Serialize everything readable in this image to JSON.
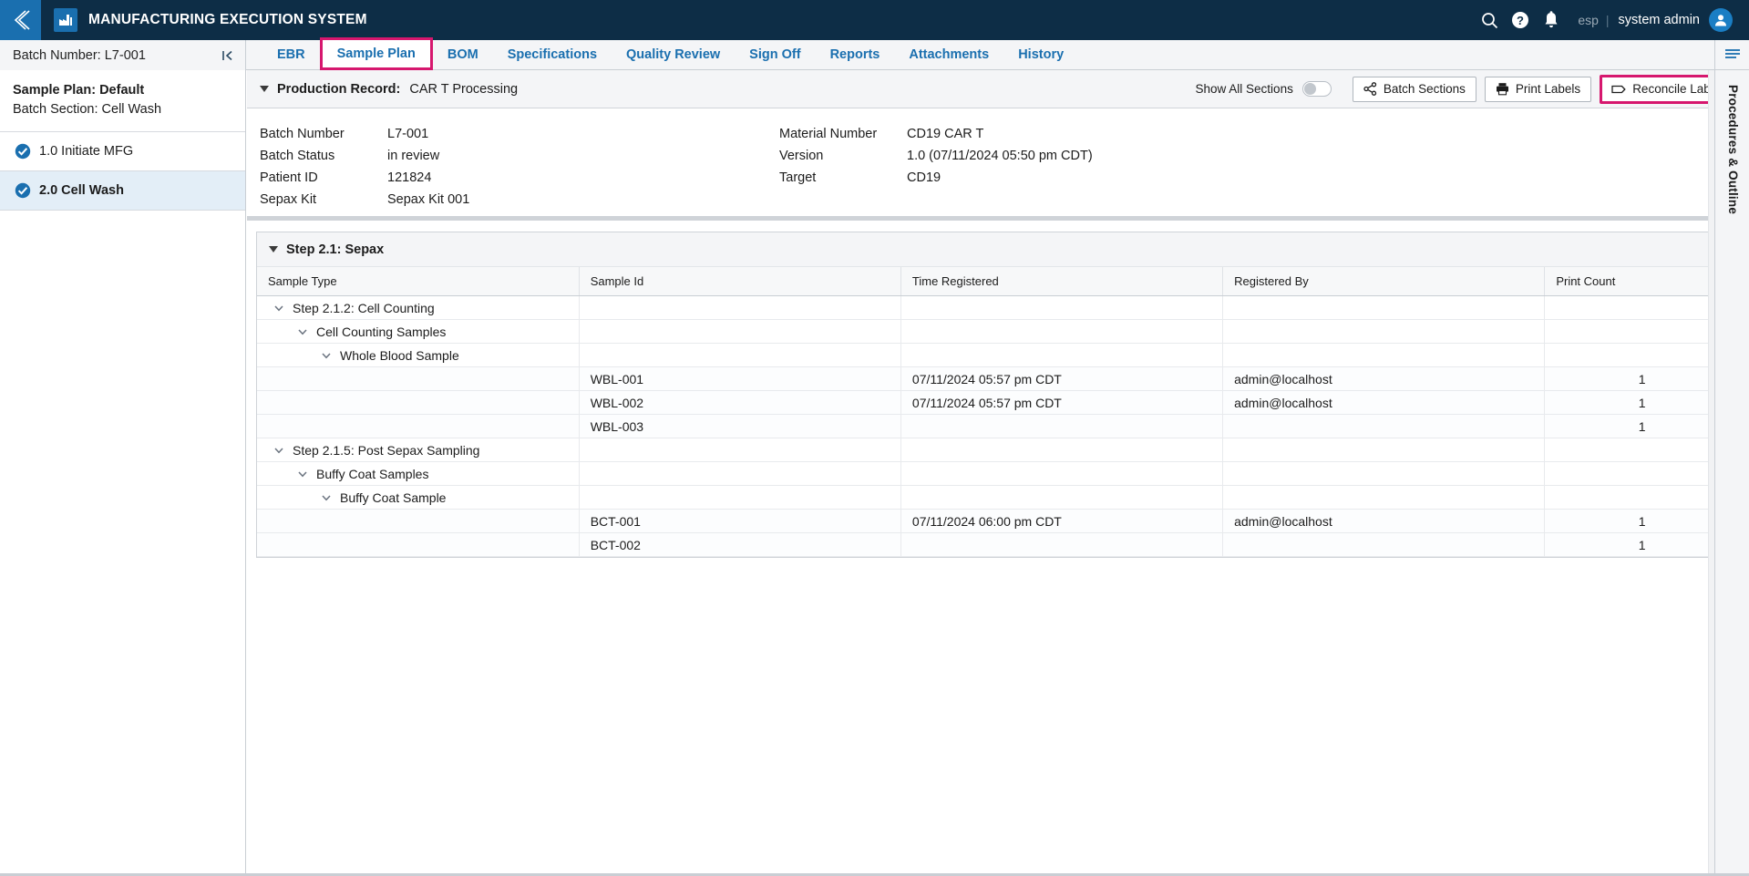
{
  "header": {
    "app_title": "MANUFACTURING EXECUTION SYSTEM",
    "collapse_icon": "chevron-left-icon",
    "logo_icon": "factory-icon",
    "search_icon": "search-icon",
    "help_icon": "help-circle-icon",
    "notifications_icon": "bell-icon",
    "language": "esp",
    "separator": "|",
    "user_name": "system admin",
    "avatar_icon": "user-avatar-icon",
    "accent_color": "#0d2d46",
    "brand_blue": "#1a6faf"
  },
  "subnav": {
    "batch_label": "Batch Number: L7-001",
    "panel_toggle_icon": "collapse-panel-icon",
    "tabs": [
      {
        "label": "EBR",
        "active": false
      },
      {
        "label": "Sample Plan",
        "active": true
      },
      {
        "label": "BOM",
        "active": false
      },
      {
        "label": "Specifications",
        "active": false
      },
      {
        "label": "Quality Review",
        "active": false
      },
      {
        "label": "Sign Off",
        "active": false
      },
      {
        "label": "Reports",
        "active": false
      },
      {
        "label": "Attachments",
        "active": false
      },
      {
        "label": "History",
        "active": false
      }
    ],
    "highlight_color": "#d6176e"
  },
  "sidebar": {
    "sample_plan_title": "Sample Plan: Default",
    "batch_section": "Batch Section: Cell Wash",
    "items": [
      {
        "label": "1.0 Initiate MFG",
        "icon": "check-circle-icon",
        "selected": false
      },
      {
        "label": "2.0 Cell Wash",
        "icon": "check-circle-icon",
        "selected": true
      }
    ]
  },
  "toolbar": {
    "caret_icon": "caret-down-icon",
    "production_record_label": "Production Record:",
    "production_record_value": "CAR T Processing",
    "show_all_sections_label": "Show All Sections",
    "show_all_sections_on": false,
    "batch_sections_label": "Batch Sections",
    "batch_sections_icon": "share-icon",
    "print_labels_label": "Print Labels",
    "print_labels_icon": "printer-icon",
    "reconcile_labels_label": "Reconcile Labels",
    "reconcile_labels_icon": "tag-icon",
    "reconcile_highlighted": true
  },
  "details": {
    "left": [
      {
        "key": "Batch Number",
        "value": "L7-001"
      },
      {
        "key": "Batch Status",
        "value": "in review"
      },
      {
        "key": "Patient ID",
        "value": "121824"
      },
      {
        "key": "Sepax Kit",
        "value": "Sepax Kit 001"
      }
    ],
    "right": [
      {
        "key": "Material Number",
        "value": "CD19 CAR T"
      },
      {
        "key": "Version",
        "value": "1.0 (07/11/2024 05:50 pm CDT)"
      },
      {
        "key": "Target",
        "value": "CD19"
      }
    ]
  },
  "step_card": {
    "caret_icon": "caret-down-icon",
    "title": "Step 2.1: Sepax",
    "columns": [
      "Sample Type",
      "Sample Id",
      "Time Registered",
      "Registered By",
      "Print Count"
    ],
    "rows": [
      {
        "kind": "group",
        "indent": 1,
        "chevron": "chevron-down-icon",
        "sample_type": "Step 2.1.2: Cell Counting",
        "sample_id": "",
        "time_registered": "",
        "registered_by": "",
        "print_count": ""
      },
      {
        "kind": "group",
        "indent": 2,
        "chevron": "chevron-down-icon",
        "sample_type": "Cell Counting Samples",
        "sample_id": "",
        "time_registered": "",
        "registered_by": "",
        "print_count": ""
      },
      {
        "kind": "group",
        "indent": 3,
        "chevron": "chevron-down-icon",
        "sample_type": "Whole Blood Sample",
        "sample_id": "",
        "time_registered": "",
        "registered_by": "",
        "print_count": ""
      },
      {
        "kind": "sample",
        "indent": 0,
        "chevron": "",
        "sample_type": "",
        "sample_id": "WBL-001",
        "time_registered": "07/11/2024 05:57 pm CDT",
        "registered_by": "admin@localhost",
        "print_count": "1"
      },
      {
        "kind": "sample",
        "indent": 0,
        "chevron": "",
        "sample_type": "",
        "sample_id": "WBL-002",
        "time_registered": "07/11/2024 05:57 pm CDT",
        "registered_by": "admin@localhost",
        "print_count": "1"
      },
      {
        "kind": "sample",
        "indent": 0,
        "chevron": "",
        "sample_type": "",
        "sample_id": "WBL-003",
        "time_registered": "",
        "registered_by": "",
        "print_count": "1"
      },
      {
        "kind": "group",
        "indent": 1,
        "chevron": "chevron-down-icon",
        "sample_type": "Step 2.1.5: Post Sepax Sampling",
        "sample_id": "",
        "time_registered": "",
        "registered_by": "",
        "print_count": ""
      },
      {
        "kind": "group",
        "indent": 2,
        "chevron": "chevron-down-icon",
        "sample_type": "Buffy Coat Samples",
        "sample_id": "",
        "time_registered": "",
        "registered_by": "",
        "print_count": ""
      },
      {
        "kind": "group",
        "indent": 3,
        "chevron": "chevron-down-icon",
        "sample_type": "Buffy Coat Sample",
        "sample_id": "",
        "time_registered": "",
        "registered_by": "",
        "print_count": ""
      },
      {
        "kind": "sample",
        "indent": 0,
        "chevron": "",
        "sample_type": "",
        "sample_id": "BCT-001",
        "time_registered": "07/11/2024 06:00 pm CDT",
        "registered_by": "admin@localhost",
        "print_count": "1"
      },
      {
        "kind": "sample",
        "indent": 0,
        "chevron": "",
        "sample_type": "",
        "sample_id": "BCT-002",
        "time_registered": "",
        "registered_by": "",
        "print_count": "1"
      }
    ]
  },
  "right_rail": {
    "menu_icon": "list-menu-icon",
    "label": "Procedures & Outline"
  }
}
